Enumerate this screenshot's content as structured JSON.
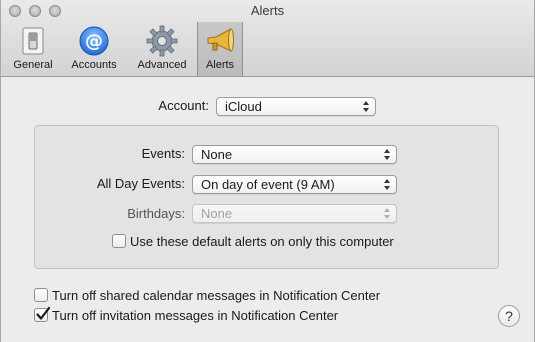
{
  "window": {
    "title": "Alerts"
  },
  "toolbar": {
    "items": [
      {
        "label": "General",
        "icon": "switch-icon"
      },
      {
        "label": "Accounts",
        "icon": "at-sign-icon"
      },
      {
        "label": "Advanced",
        "icon": "gear-icon"
      },
      {
        "label": "Alerts",
        "icon": "megaphone-icon",
        "selected": true
      }
    ]
  },
  "account": {
    "label": "Account:",
    "value": "iCloud"
  },
  "alerts": {
    "events": {
      "label": "Events:",
      "value": "None"
    },
    "all_day_events": {
      "label": "All Day Events:",
      "value": "On day of event (9 AM)"
    },
    "birthdays": {
      "label": "Birthdays:",
      "value": "None",
      "disabled": true
    },
    "default_alerts_checkbox": {
      "label": "Use these default alerts on only this computer",
      "checked": false
    }
  },
  "notifications": {
    "shared_calendar": {
      "label": "Turn off shared calendar messages in Notification Center",
      "checked": false
    },
    "invitations": {
      "label": "Turn off invitation messages in Notification Center",
      "checked": true
    }
  },
  "help": {
    "label": "?"
  },
  "colors": {
    "accent": "#3b7fd9",
    "selected_tab": "#c2c2c2"
  }
}
